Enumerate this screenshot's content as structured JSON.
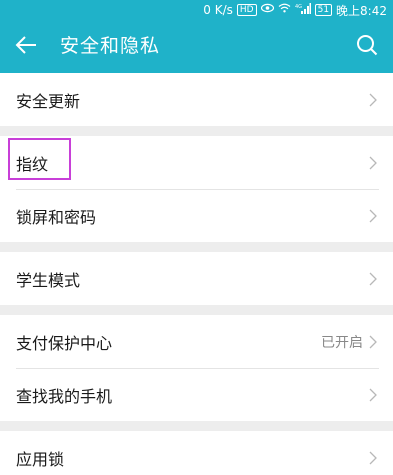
{
  "status_bar": {
    "speed": "0 K/s",
    "hd_badge": "HD",
    "signal": "4G",
    "battery": "51",
    "time": "晚上8:42"
  },
  "header": {
    "title": "安全和隐私",
    "back_icon": "arrow-left-icon",
    "search_icon": "search-icon"
  },
  "groups": [
    {
      "items": [
        {
          "label": "安全更新"
        }
      ]
    },
    {
      "items": [
        {
          "label": "指纹"
        },
        {
          "label": "锁屏和密码"
        }
      ]
    },
    {
      "items": [
        {
          "label": "学生模式"
        }
      ]
    },
    {
      "items": [
        {
          "label": "支付保护中心",
          "status": "已开启"
        },
        {
          "label": "查找我的手机"
        }
      ]
    },
    {
      "items": [
        {
          "label": "应用锁"
        }
      ]
    }
  ],
  "colors": {
    "header_bg": "#1fb2c9",
    "highlight": "#c83fd8"
  }
}
